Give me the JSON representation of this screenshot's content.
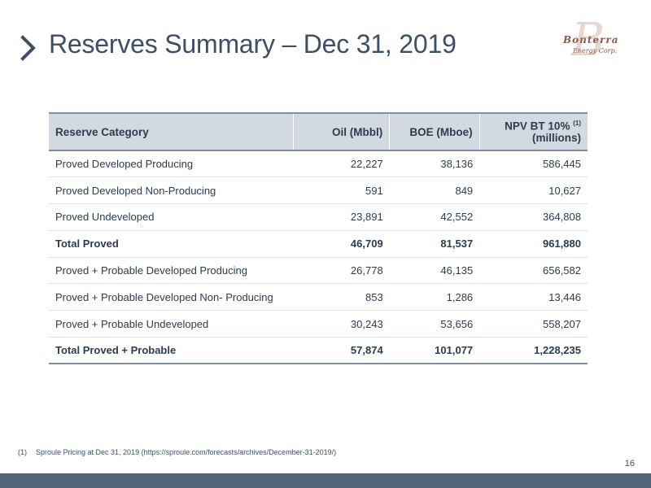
{
  "slide": {
    "title": "Reserves Summary – Dec 31, 2019",
    "page_number": "16"
  },
  "logo": {
    "name": "Bonterra",
    "subtitle": "Energy Corp."
  },
  "table": {
    "headers": {
      "category": "Reserve Category",
      "oil": "Oil (Mbbl)",
      "boe": "BOE (Mboe)",
      "npv_line1": "NPV BT 10%",
      "npv_note": "(1)",
      "npv_line2": "(millions)"
    },
    "rows": [
      {
        "category": "Proved Developed Producing",
        "oil": "22,227",
        "boe": "38,136",
        "npv": "586,445",
        "bold": false
      },
      {
        "category": "Proved Developed Non-Producing",
        "oil": "591",
        "boe": "849",
        "npv": "10,627",
        "bold": false
      },
      {
        "category": "Proved Undeveloped",
        "oil": "23,891",
        "boe": "42,552",
        "npv": "364,808",
        "bold": false
      },
      {
        "category": "Total Proved",
        "oil": "46,709",
        "boe": "81,537",
        "npv": "961,880",
        "bold": true
      },
      {
        "category": "Proved + Probable Developed Producing",
        "oil": "26,778",
        "boe": "46,135",
        "npv": "656,582",
        "bold": false
      },
      {
        "category": "Proved + Probable Developed Non- Producing",
        "oil": "853",
        "boe": "1,286",
        "npv": "13,446",
        "bold": false
      },
      {
        "category": "Proved + Probable Undeveloped",
        "oil": "30,243",
        "boe": "53,656",
        "npv": "558,207",
        "bold": false
      },
      {
        "category": "Total Proved + Probable",
        "oil": "57,874",
        "boe": "101,077",
        "npv": "1,228,235",
        "bold": true
      }
    ]
  },
  "footnote": {
    "marker": "(1)",
    "text": "Sproule Pricing at Dec 31, 2019 (https://sproule.com/forecasts/archives/December-31-2019/)"
  },
  "colors": {
    "title": "#3d4f66",
    "header_fill": "#d3d9e1",
    "rule": "#7f8fa3",
    "bottom_bar": "#55667a",
    "logo_accent": "#8a5a48"
  }
}
